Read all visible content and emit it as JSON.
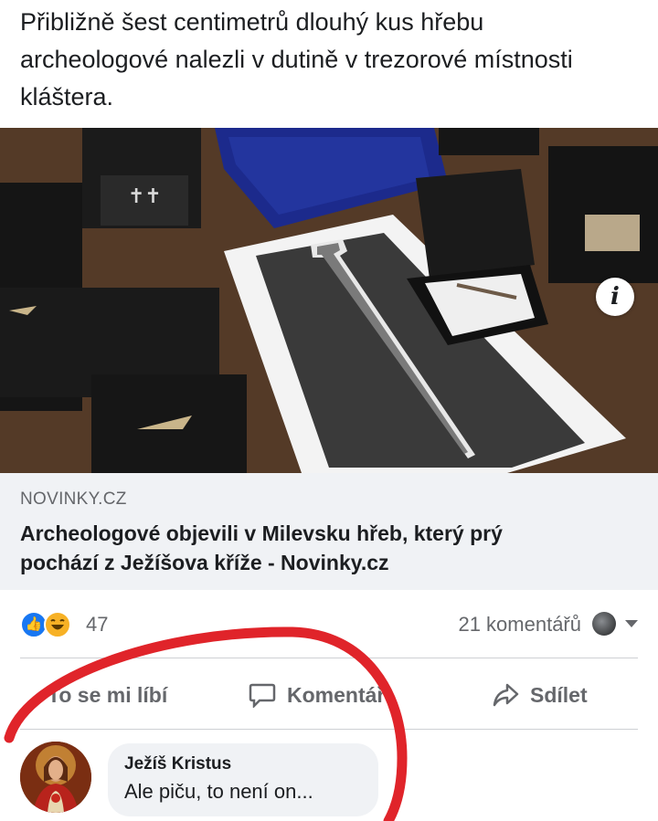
{
  "post": {
    "text": "Přibližně šest centimetrů dlouhý kus hřebu\narcheologové nalezli v dutině v trezorové místnosti\nkláštera."
  },
  "link": {
    "info_glyph": "i",
    "domain": "NOVINKY.CZ",
    "title": "Archeologové objevili v Milevsku hřeb, který prý\npochází z Ježíšova kříže - Novinky.cz"
  },
  "reactions": {
    "icons": [
      "like-icon",
      "haha-icon"
    ],
    "count": "47",
    "comments": "21 komentářů"
  },
  "actions": {
    "like_label": "To se mi líbí",
    "comment_label": "Komentář",
    "share_label": "Sdílet"
  },
  "comment": {
    "author": "Ježíš Kristus",
    "text": "Ale piču, to není on..."
  },
  "colors": {
    "accent": "#1877f2",
    "muted_text": "#65676b",
    "scribble": "#e0242a"
  }
}
